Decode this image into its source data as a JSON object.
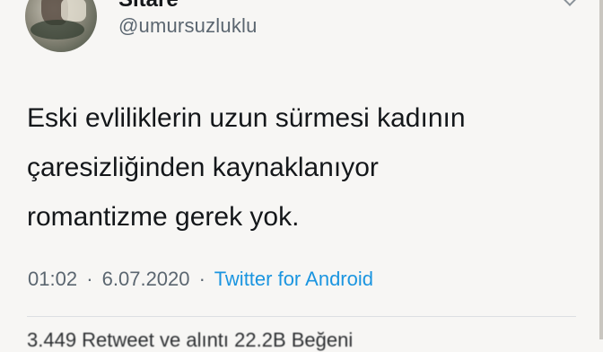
{
  "user": {
    "display_name": "Sitare",
    "handle": "@umursuzluklu"
  },
  "tweet": {
    "lines": [
      "Eski evliliklerin uzun sürmesi kadının",
      "çaresizliğinden kaynaklanıyor",
      "romantizme gerek yok."
    ],
    "time": "01:02",
    "date": "6.07.2020",
    "separator": "·",
    "source": "Twitter for Android"
  },
  "stats_partial": "3.449 Retweet ve alıntı   22.2B Beğeni",
  "colors": {
    "link": "#1b95e0",
    "secondary_text": "#5b6670"
  },
  "icons": {
    "menu": "chevron-down-icon"
  }
}
